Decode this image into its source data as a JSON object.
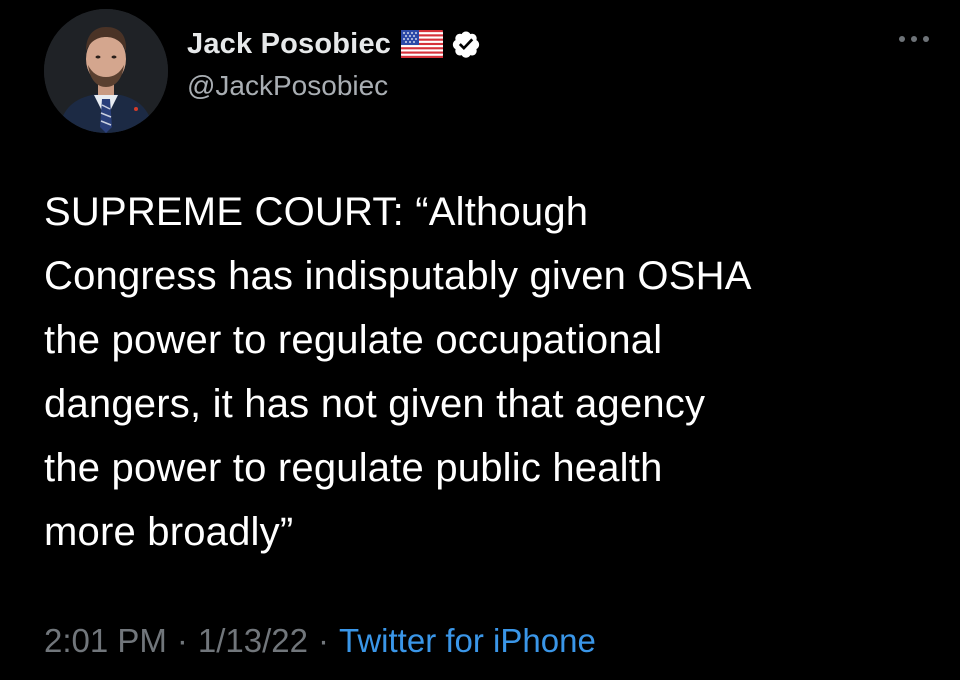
{
  "author": {
    "display_name": "Jack Posobiec",
    "handle": "@JackPosobiec",
    "flag": "us-flag-icon",
    "verified": true
  },
  "tweet": {
    "text": "SUPREME COURT: “Although\nCongress has indisputably given OSHA\nthe power to regulate occupational\ndangers, it has not given that agency\nthe power to regulate public health\nmore broadly”"
  },
  "meta": {
    "time": "2:01 PM",
    "date": "1/13/22",
    "separator": "·",
    "source": "Twitter for iPhone"
  },
  "colors": {
    "background": "#000000",
    "text": "#ffffff",
    "muted": "#71767b",
    "link": "#3a96e8"
  },
  "icons": {
    "more": "more-horizontal-icon",
    "verified": "verified-badge-icon"
  }
}
